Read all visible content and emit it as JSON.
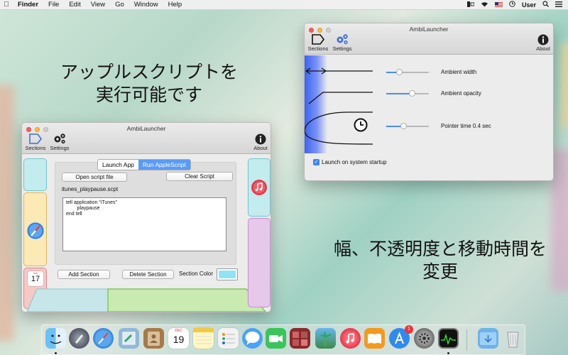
{
  "menubar": {
    "app": "Finder",
    "items": [
      "File",
      "Edit",
      "View",
      "Go",
      "Window",
      "Help"
    ],
    "user": "User"
  },
  "captions": {
    "top_left_line1": "アップルスクリプトを",
    "top_left_line2": "実行可能です",
    "bottom_right_line1": "幅、不透明度と移動時間を",
    "bottom_right_line2": "変更"
  },
  "main_window": {
    "title": "AmbiLauncher",
    "toolbar": {
      "sections": "Sections",
      "settings": "Settings",
      "about": "About"
    },
    "tabs": [
      {
        "label": "Launch App",
        "active": false
      },
      {
        "label": "Run AppleScript",
        "active": true
      }
    ],
    "open_script_button": "Open script file",
    "clear_script_button": "Clear Script",
    "script_filename": "itunes_playpause.scpt",
    "script_text": "tell application \"iTunes\"\n        playpause\nend tell",
    "add_section_button": "Add Section",
    "delete_section_button": "Delete Section",
    "section_color_label": "Section Color",
    "section_color": "#8ee4f4",
    "calendar_month": "JUL",
    "calendar_day": "17"
  },
  "ambi_window": {
    "title": "AmbiLauncher",
    "toolbar": {
      "sections": "Sections",
      "settings": "Settings",
      "about": "About"
    },
    "sliders": [
      {
        "label": "Ambient width",
        "value": 0.3
      },
      {
        "label": "Ambient opacity",
        "value": 0.6
      },
      {
        "label": "Pointer time 0.4 sec",
        "value": 0.4
      }
    ],
    "launch_on_startup_label": "Launch on system startup",
    "launch_on_startup": true
  },
  "dock": {
    "app_store_badge": "1",
    "calendar_month": "DEC",
    "calendar_day": "19"
  },
  "colors": {
    "accent": "#4b8cf5",
    "seg_active": "#5a9bf6"
  }
}
